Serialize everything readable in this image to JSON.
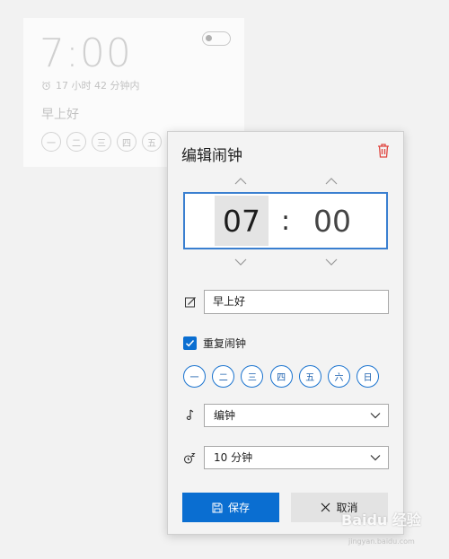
{
  "background_alarm": {
    "time": "7:00",
    "countdown": "17 小时 42 分钟内",
    "name": "早上好",
    "days": [
      "一",
      "二",
      "三",
      "四",
      "五"
    ]
  },
  "editor": {
    "title": "编辑闹钟",
    "hour": "07",
    "separator": ":",
    "minute": "00",
    "alarm_name": "早上好",
    "repeat_label": "重复闹钟",
    "repeat_checked": true,
    "days": [
      "一",
      "二",
      "三",
      "四",
      "五",
      "六",
      "日"
    ],
    "sound": "编钟",
    "snooze": "10 分钟",
    "save_label": "保存",
    "cancel_label": "取消"
  },
  "watermark": {
    "brand": "Baidu 经验",
    "url": "jingyan.baidu.com"
  },
  "colors": {
    "accent": "#0a6ed1",
    "delete": "#e0453f"
  }
}
